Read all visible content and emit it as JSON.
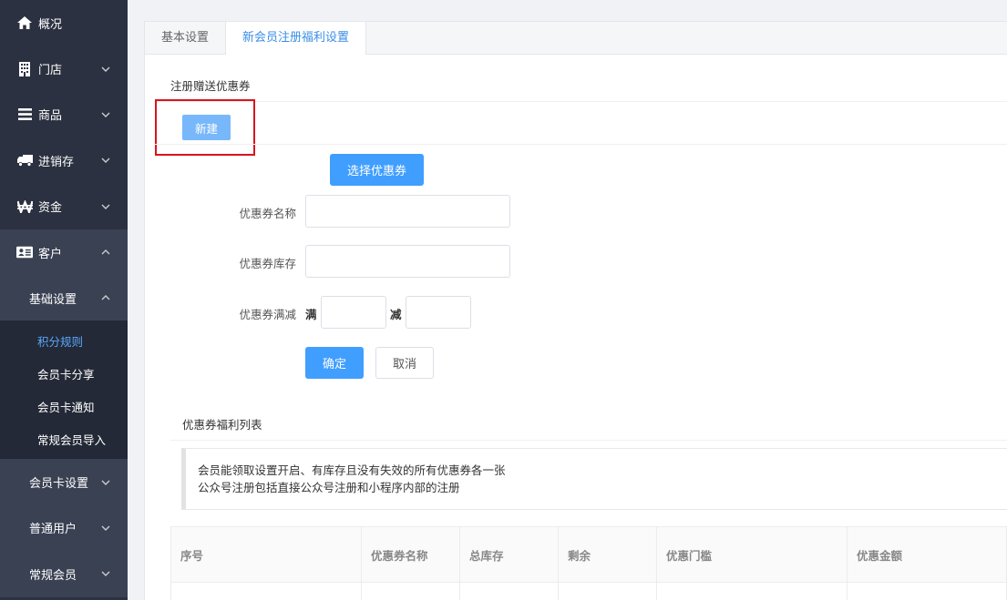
{
  "sidebar": {
    "items": [
      {
        "label": "概况",
        "icon": "home-icon"
      },
      {
        "label": "门店",
        "icon": "building-icon"
      },
      {
        "label": "商品",
        "icon": "list-icon"
      },
      {
        "label": "进销存",
        "icon": "truck-icon"
      },
      {
        "label": "资金",
        "icon": "won-icon"
      },
      {
        "label": "客户",
        "icon": "id-card-icon"
      }
    ],
    "sub_open": "基础设置",
    "leaves": [
      "积分规则",
      "会员卡分享",
      "会员卡通知",
      "常规会员导入"
    ],
    "sub_closed": [
      "会员卡设置",
      "普通用户",
      "常规会员"
    ]
  },
  "tabs": [
    {
      "label": "基本设置",
      "active": false
    },
    {
      "label": "新会员注册福利设置",
      "active": true
    }
  ],
  "section": {
    "title": "注册赠送优惠券",
    "new_button": "新建",
    "select_button": "选择优惠券"
  },
  "form": {
    "name_label": "优惠券名称",
    "name_value": "",
    "stock_label": "优惠券库存",
    "stock_value": "",
    "threshold_label": "优惠券满减",
    "full_word": "满",
    "full_value": "",
    "minus_word": "减",
    "minus_value": "",
    "ok_button": "确定",
    "cancel_button": "取消"
  },
  "list": {
    "title": "优惠券福利列表",
    "notice_line1": "会员能领取设置开启、有库存且没有失效的所有优惠券各一张",
    "notice_line2": "公众号注册包括直接公众号注册和小程序内部的注册",
    "columns": [
      "序号",
      "优惠券名称",
      "总库存",
      "剩余",
      "优惠门槛",
      "优惠金额"
    ]
  },
  "colors": {
    "sidebar_bg": "#2b3140",
    "accent": "#409eff",
    "active_leaf": "#5aa9ff",
    "highlight": "#d9141b"
  }
}
